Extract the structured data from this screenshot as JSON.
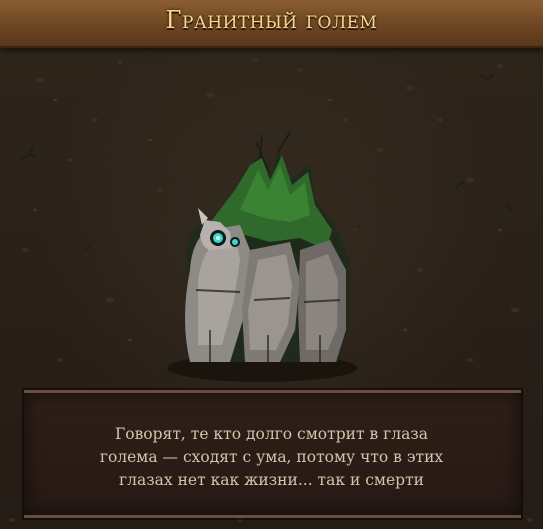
{
  "card": {
    "title": "Гранитный голем",
    "creature_image": "granite-golem-illustration",
    "description_lines": [
      "Говорят, те кто долго смотрит в глаза",
      "голема — сходят с ума, потому что в этих",
      "глазах нет как жизни... так и смерти"
    ]
  },
  "colors": {
    "title_bar": "#7a512b",
    "title_text": "#f3d98a",
    "background": "#2a2119",
    "panel": "#2b1c16",
    "panel_border": "#6a4c41",
    "description_text": "#d6c3ad",
    "golem_eye": "#3fd6c8",
    "moss": "#2f6a2c"
  }
}
